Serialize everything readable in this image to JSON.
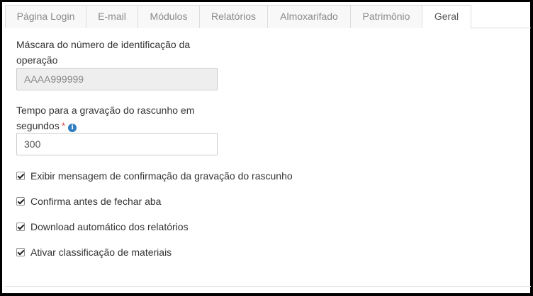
{
  "tabs": [
    {
      "label": "Página Login",
      "active": false
    },
    {
      "label": "E-mail",
      "active": false
    },
    {
      "label": "Módulos",
      "active": false
    },
    {
      "label": "Relatórios",
      "active": false
    },
    {
      "label": "Almoxarifado",
      "active": false
    },
    {
      "label": "Patrimônio",
      "active": false
    },
    {
      "label": "Geral",
      "active": true
    }
  ],
  "form": {
    "mask_field": {
      "label": "Máscara do número de identificação da operação",
      "value": "AAAA999999",
      "disabled": true
    },
    "draft_time_field": {
      "label": "Tempo para a gravação do rascunho em segundos",
      "required_marker": "*",
      "info_icon": "info-circle-icon",
      "value": "300"
    },
    "checkboxes": [
      {
        "label": "Exibir mensagem de confirmação da gravação do rascunho",
        "checked": true
      },
      {
        "label": "Confirma antes de fechar aba",
        "checked": true
      },
      {
        "label": "Download automático dos relatórios",
        "checked": true
      },
      {
        "label": "Ativar classificação de materiais",
        "checked": true
      }
    ]
  },
  "colors": {
    "required": "#d9534f",
    "info": "#2f7dc1",
    "disabled_input_bg": "#eeeeee",
    "tab_border": "#dddddd"
  }
}
